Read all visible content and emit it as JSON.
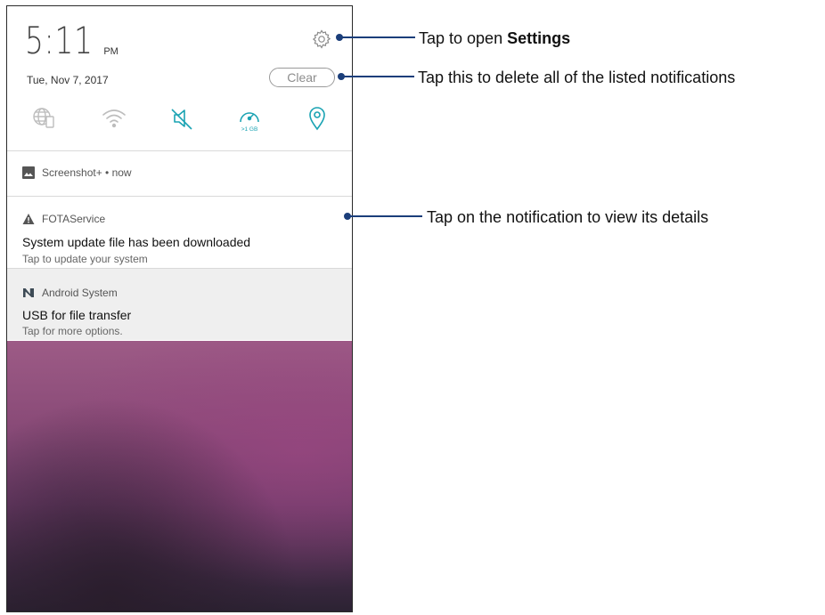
{
  "status": {
    "time": "5:11",
    "ampm": "PM",
    "date": "Tue, Nov 7, 2017",
    "clear_label": "Clear"
  },
  "quick_settings": [
    {
      "icon": "globe-sim-icon",
      "color": "#bdbdbd"
    },
    {
      "icon": "wifi-icon",
      "color": "#bdbdbd"
    },
    {
      "icon": "mute-icon",
      "color": "#1aa3b3"
    },
    {
      "icon": "data-usage-icon",
      "color": "#1aa3b3",
      "label": ">1 GB"
    },
    {
      "icon": "location-icon",
      "color": "#1aa3b3"
    }
  ],
  "notifications": [
    {
      "app": "Screenshot+ • now",
      "icon": "image-icon"
    },
    {
      "app": "FOTAService",
      "icon": "warning-icon",
      "title": "System update file has been downloaded",
      "text": "Tap to update your system"
    },
    {
      "app": "Android System",
      "icon": "android-n-icon",
      "title": "USB for file transfer",
      "text": "Tap for more options."
    }
  ],
  "callouts": {
    "settings_prefix": "Tap to open ",
    "settings_bold": "Settings",
    "clear": "Tap this to delete all of the listed notifications",
    "notification": "Tap on the notification to view its details"
  },
  "colors": {
    "accent": "#1aa3b3",
    "callout": "#1b3e7a"
  }
}
